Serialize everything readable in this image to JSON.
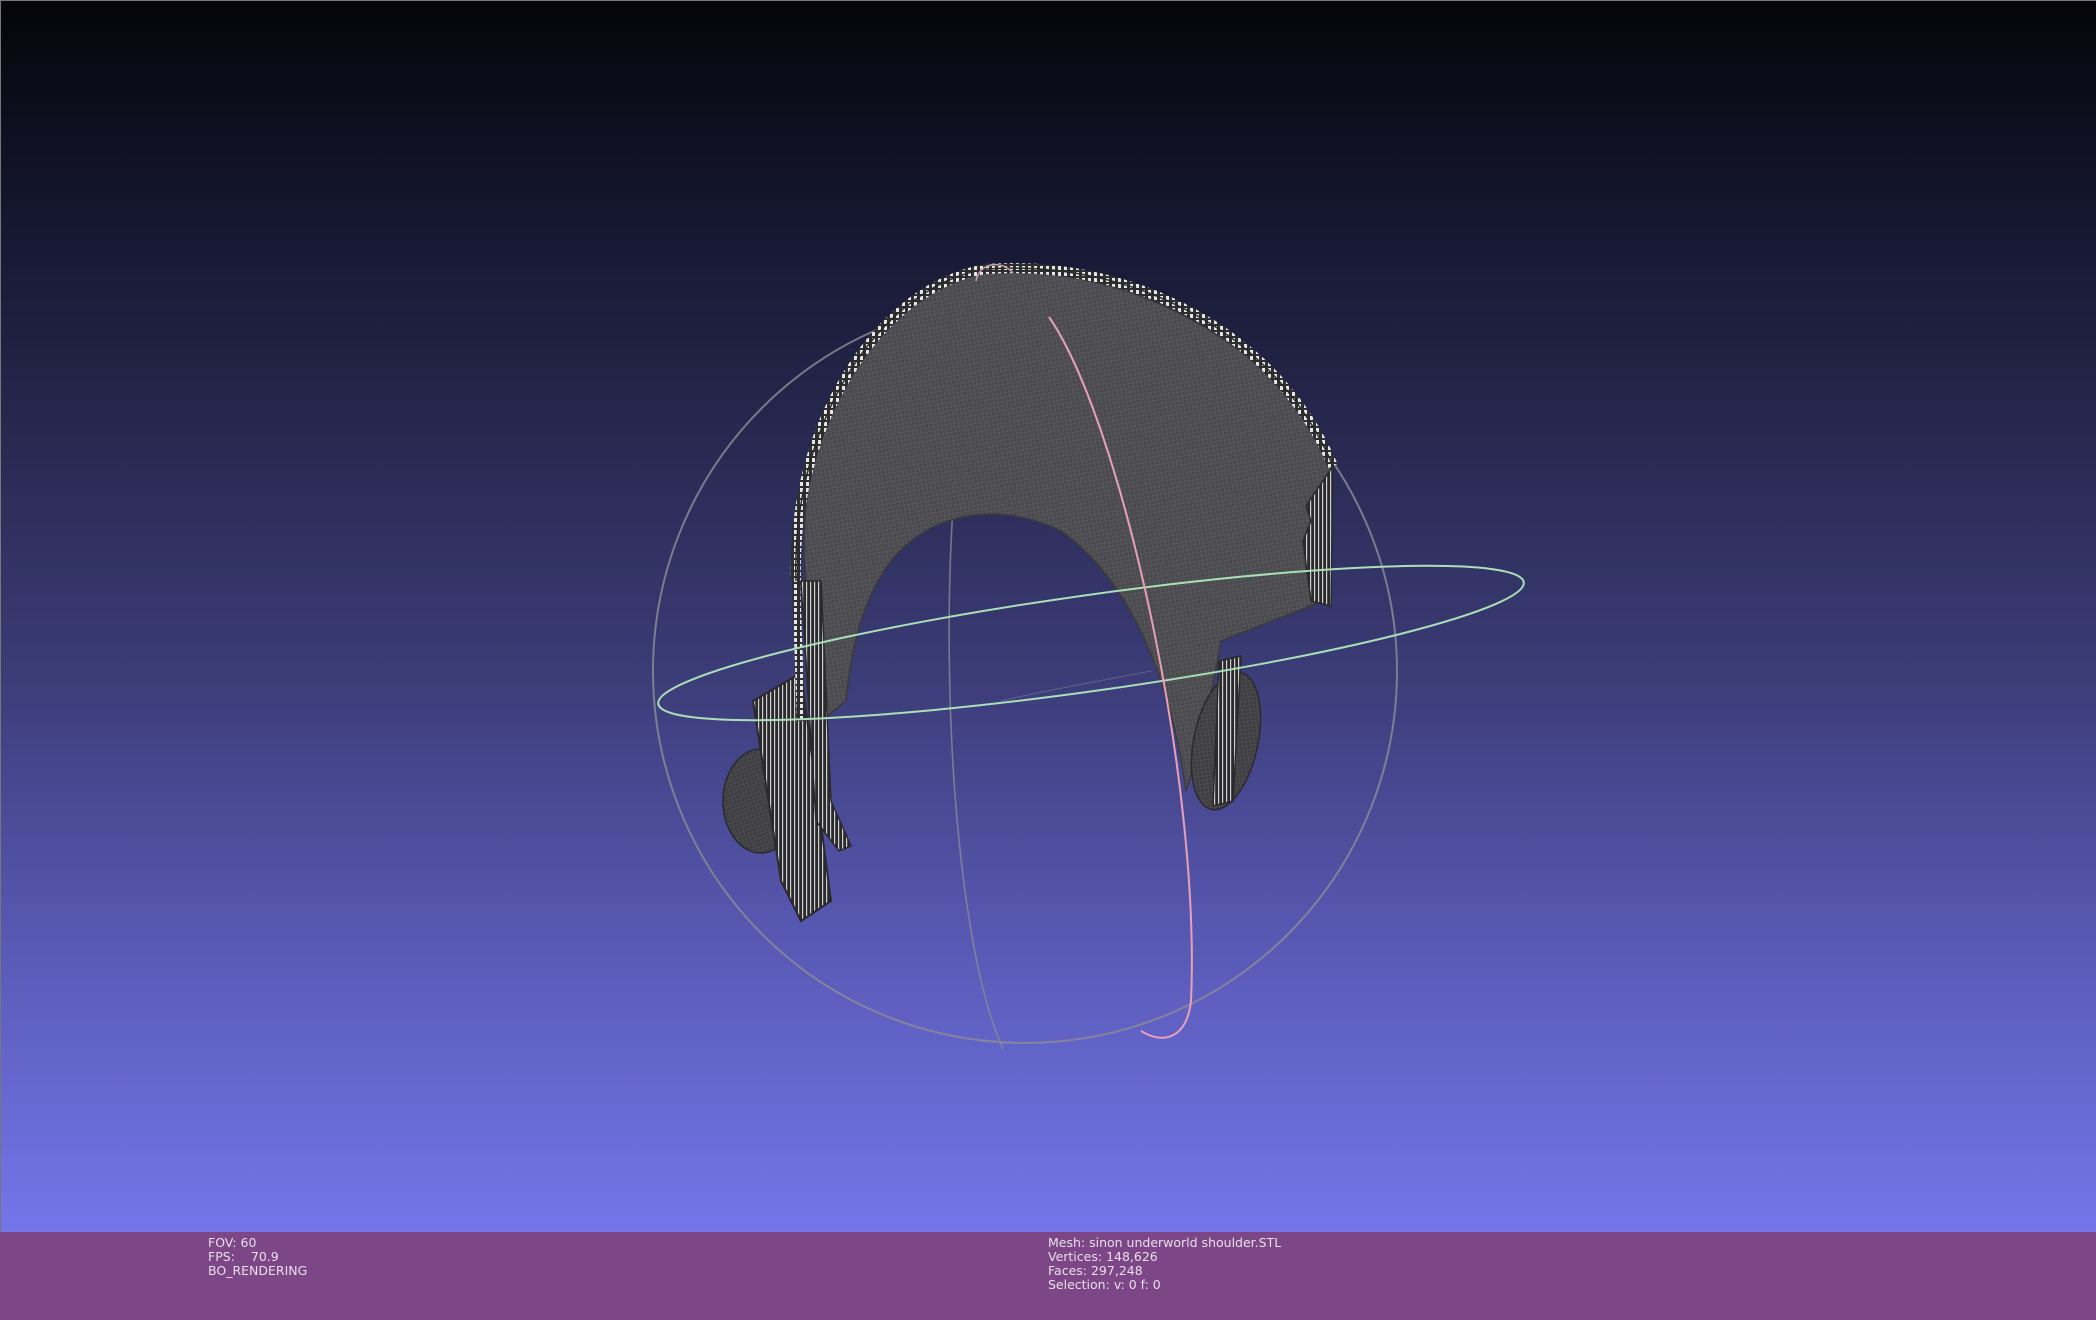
{
  "viewer": {
    "fov_label": "FOV:",
    "fov_value": "60",
    "fps_label": "FPS:",
    "fps_value": "70.9",
    "render_mode": "BO_RENDERING"
  },
  "mesh_info": {
    "mesh_label": "Mesh:",
    "mesh_name": "sinon underworld shoulder.STL",
    "vertices_label": "Vertices:",
    "vertices_value": "148,626",
    "faces_label": "Faces:",
    "faces_value": "297,248",
    "selection_label": "Selection:",
    "selection_value": "v: 0 f: 0"
  },
  "colors": {
    "background_top": "#050509",
    "background_bottom": "#7575ea",
    "statusbar": "#7d4686",
    "trackball_gray": "#8a8a96",
    "trackball_green": "#a8e0b8",
    "trackball_pink": "#e8a0b8",
    "mesh": "#4a4a4e",
    "mesh_edge": "#d8d8d8"
  }
}
